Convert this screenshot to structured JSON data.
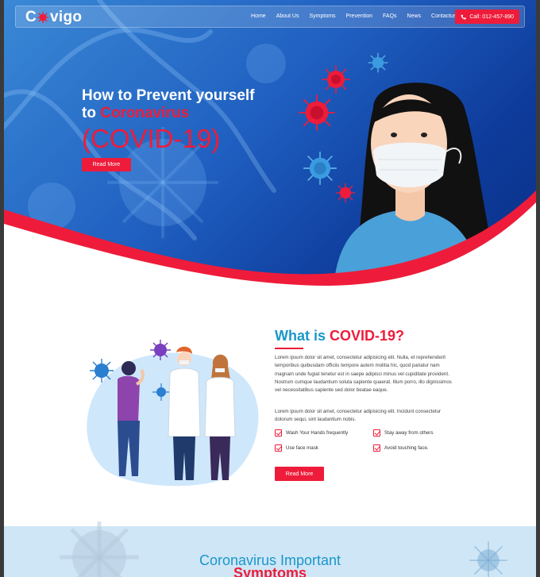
{
  "nav": {
    "logo": "vigo",
    "logo_prefix": "C",
    "menu": [
      "Home",
      "About Us",
      "Symptoms",
      "Prevention",
      "FAQs",
      "News",
      "Contactus"
    ],
    "call_label": "Call: 012-457-890"
  },
  "hero": {
    "title_line1": "How to Prevent yourself",
    "title_line2_prefix": "to",
    "title_line2_red": "Coronavirus",
    "big": "(COVID-19)",
    "button": "Read More"
  },
  "about": {
    "heading_prefix": "What is",
    "heading_red": "COVID-19?",
    "paragraph1": "Lorem ipsum dolor sit amet, consectetur adipisicing elit. Nulla, et reprehenderit temporibus quibusdam officiis tempore autem molitia hic, quod pariatur nam magnam unde fugiat tenetur est in saepe adipisci minus vel cupiditate provident. Nostrum cumque laudantium soluta sapiente quaerat. Illum porro, illo dignissimos vel necessitatibus sapiente sed dolor beatae eaque.",
    "paragraph2": "Lorem ipsum dolor sit amet, consectetur adipisicing elit. Incidunt consectetur dolorum sequi, sint laudantium nobis.",
    "checks": [
      "Wash Your Hands frequently",
      "Stay away from others",
      "Use face mask",
      "Avoid touching face."
    ],
    "button": "Read More"
  },
  "symptoms": {
    "heading_line1": "Coronavirus Important",
    "heading_line2": "Symptoms"
  },
  "colors": {
    "accent_red": "#ee1c3a",
    "accent_blue": "#1a97c9",
    "hero_blue": "#0e3c9c"
  }
}
